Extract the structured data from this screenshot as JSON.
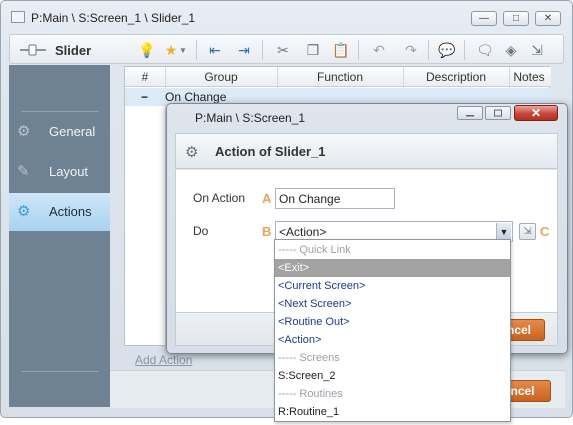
{
  "window": {
    "title": "P:Main \\ S:Screen_1 \\ Slider_1",
    "buttons": {
      "minimize": "—",
      "maximize": "□",
      "close": "✕"
    }
  },
  "toolbar": {
    "title": "Slider"
  },
  "sidebar": {
    "items": [
      {
        "label": "General",
        "icon": "general-icon"
      },
      {
        "label": "Layout",
        "icon": "layout-icon"
      },
      {
        "label": "Actions",
        "icon": "actions-icon",
        "active": true
      }
    ]
  },
  "grid": {
    "columns": [
      "#",
      "Group",
      "Function",
      "Description",
      "Notes"
    ],
    "rows": [
      {
        "num": "−",
        "group": "On Change"
      }
    ]
  },
  "add_action_label": "Add Action",
  "outer_cancel_label": "ncel",
  "dialog": {
    "title": "P:Main \\ S:Screen_1",
    "close_label": "✕",
    "header_title": "Action of Slider_1",
    "on_action_label": "On Action",
    "on_action_value": "On Change",
    "do_label": "Do",
    "do_value": "<Action>",
    "marker_a": "A",
    "marker_b": "B",
    "marker_c": "C",
    "cancel_label": "ncel"
  },
  "dropdown": {
    "items": [
      {
        "label": "----- Quick Link",
        "kind": "header"
      },
      {
        "label": "<Exit>",
        "kind": "selected"
      },
      {
        "label": "<Current Screen>",
        "kind": "option"
      },
      {
        "label": "<Next Screen>",
        "kind": "option"
      },
      {
        "label": "<Routine Out>",
        "kind": "option"
      },
      {
        "label": "<Action>",
        "kind": "option"
      },
      {
        "label": "----- Screens",
        "kind": "header"
      },
      {
        "label": "S:Screen_2",
        "kind": "plain"
      },
      {
        "label": "----- Routines",
        "kind": "header"
      },
      {
        "label": "R:Routine_1",
        "kind": "plain"
      }
    ]
  },
  "colors": {
    "accent_orange": "#d2702d",
    "sidebar": "#6f8294",
    "selection": "#a3a3a3",
    "link_blue": "#1e3a8c"
  }
}
